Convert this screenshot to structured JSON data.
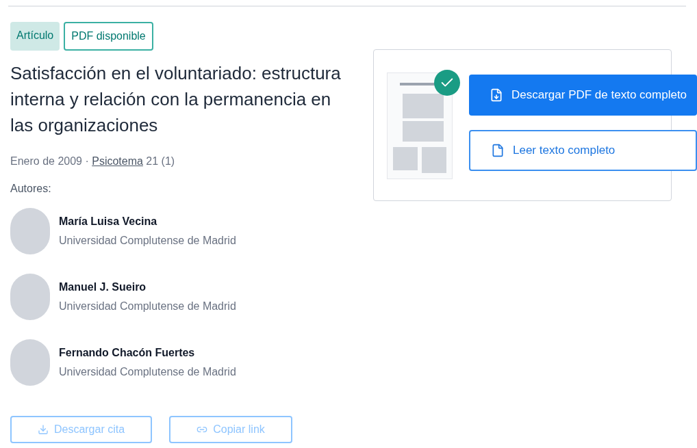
{
  "tags": [
    {
      "label": "Artículo",
      "kind": "filled"
    },
    {
      "label": "PDF disponible",
      "kind": "outlined"
    }
  ],
  "title": "Satisfacción en el voluntariado: estructura interna y relación con la permanencia en las organizaciones",
  "meta": {
    "date": "Enero de 2009 · ",
    "journal": "Psicotema",
    "issue": " 21 (1)"
  },
  "authors_label": "Autores:",
  "authors": [
    {
      "name": "María Luisa Vecina",
      "affiliation": "Universidad Complutense de Madrid"
    },
    {
      "name": "Manuel J. Sueiro",
      "affiliation": "Universidad Complutense de Madrid"
    },
    {
      "name": "Fernando Chacón Fuertes",
      "affiliation": "Universidad Complutense de Madrid"
    }
  ],
  "preview": {
    "pdf_available": true
  },
  "actions": [
    {
      "label": "Descargar PDF de texto completo",
      "kind": "primary"
    },
    {
      "label": "Leer texto completo",
      "kind": "secondary"
    }
  ],
  "footer_buttons": [
    {
      "label": "Descargar cita",
      "kind": "download"
    },
    {
      "label": "Copiar link",
      "kind": "link"
    }
  ]
}
